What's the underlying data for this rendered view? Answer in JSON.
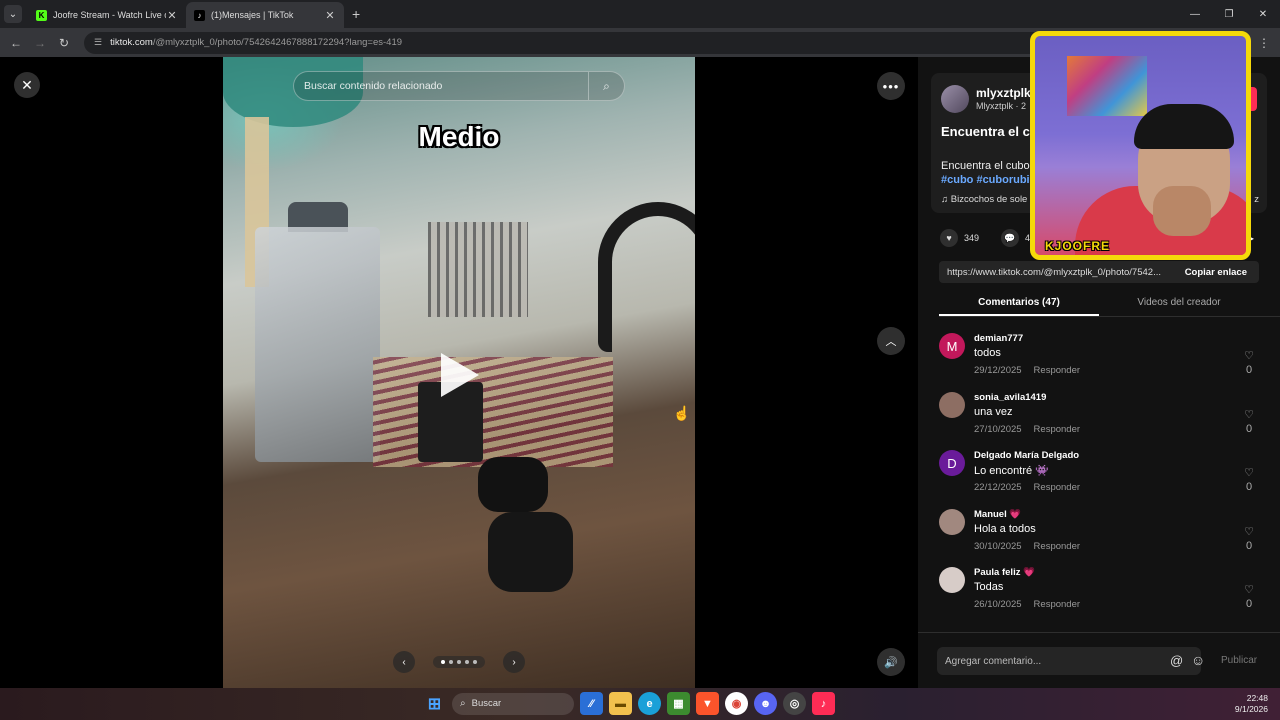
{
  "browser": {
    "tabs": [
      {
        "title": "Joofre Stream - Watch Live on K",
        "favicon": "K",
        "favicon_color": "#53fc18"
      },
      {
        "title": "(1)Mensajes | TikTok",
        "favicon": "♪",
        "favicon_color": "#ffffff"
      }
    ],
    "url_main": "tiktok.com",
    "url_rest": "/@mlyxztplk_0/photo/7542642467888172294?lang=es-419"
  },
  "viewer": {
    "search_placeholder": "Buscar contenido relacionado",
    "overlay_text": "Medio",
    "carousel_dots": 5,
    "active_dot": 1
  },
  "post": {
    "username": "mlyxztplk",
    "subline": "Mlyxztplk · 2",
    "title": "Encuentra el c desorden",
    "description": "Encuentra el cubo",
    "tags": "#cubo #cuborubi",
    "music": "Bizcochos de sole",
    "music_end": "z",
    "likes": "349",
    "comments_count": "47",
    "link": "https://www.tiktok.com/@mlyxztplk_0/photo/7542...",
    "copy_label": "Copiar enlace"
  },
  "tabs": {
    "comments": "Comentarios (47)",
    "creator_videos": "Videos del creador"
  },
  "comments": [
    {
      "name": "demian777",
      "text": "todos",
      "date": "29/12/2025",
      "reply": "Responder",
      "likes": "0",
      "avatar": "M",
      "avatar_color": "#c2185b"
    },
    {
      "name": "sonia_avila1419",
      "text": "una vez",
      "date": "27/10/2025",
      "reply": "Responder",
      "likes": "0",
      "avatar": "",
      "avatar_color": "#8d6e63"
    },
    {
      "name": "Delgado María Delgado",
      "text": "Lo encontré 👾",
      "date": "22/12/2025",
      "reply": "Responder",
      "likes": "0",
      "avatar": "D",
      "avatar_color": "#6a1b9a"
    },
    {
      "name": "Manuel 💗",
      "text": "Hola a todos",
      "date": "30/10/2025",
      "reply": "Responder",
      "likes": "0",
      "avatar": "",
      "avatar_color": "#a1887f"
    },
    {
      "name": "Paula feliz 💗",
      "text": "Todas",
      "date": "26/10/2025",
      "reply": "Responder",
      "likes": "0",
      "avatar": "",
      "avatar_color": "#d7ccc8"
    }
  ],
  "composer": {
    "placeholder": "Agregar comentario...",
    "publish": "Publicar"
  },
  "webcam": {
    "label": "KJOOFRE"
  },
  "taskbar": {
    "search": "Buscar",
    "time": "22:48",
    "date": "9/1/2026"
  }
}
